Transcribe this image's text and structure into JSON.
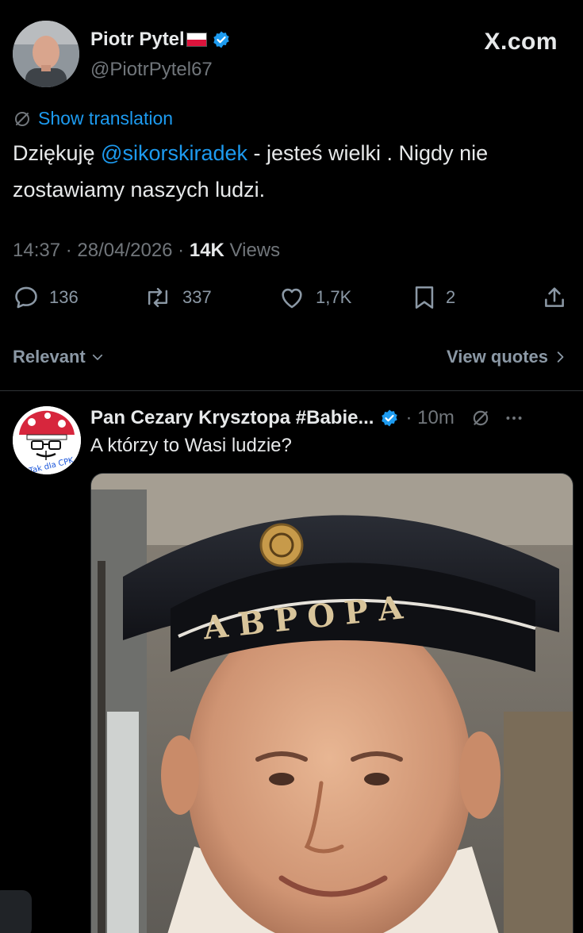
{
  "tweet": {
    "author_name": "Piotr Pytel",
    "author_flag": "Poland flag",
    "author_handle": "@PiotrPytel67",
    "brand": "X.com",
    "show_translation": "Show translation",
    "text_before": "Dziękuję ",
    "mention": "@sikorskiradek",
    "text_after": " - jesteś wielki . Nigdy nie zostawiamy naszych ludzi.",
    "time": "14:37",
    "separator": " · ",
    "date": "28/04/2026",
    "views_count": "14K",
    "views_label": " Views",
    "replies": "136",
    "reposts": "337",
    "likes": "1,7K",
    "bookmarks": "2"
  },
  "filter": {
    "relevant_label": "Relevant",
    "view_quotes_label": "View quotes"
  },
  "reply": {
    "name": "Pan Cezary Krysztopa #Babie...",
    "time": "10m",
    "text": "A którzy to Wasi ludzie?",
    "avatar_text": "Tak dla CPK",
    "photo_cap_text": "АВРОРА"
  },
  "colors": {
    "accent": "#1d9bf0",
    "muted": "#71767b",
    "text": "#e7e9ea",
    "background": "#000000"
  },
  "icons": [
    "verified-badge-icon",
    "translate-icon",
    "reply-icon",
    "repost-icon",
    "like-icon",
    "bookmark-icon",
    "share-icon",
    "chevron-down-icon",
    "chevron-right-icon",
    "grok-icon",
    "more-icon"
  ]
}
